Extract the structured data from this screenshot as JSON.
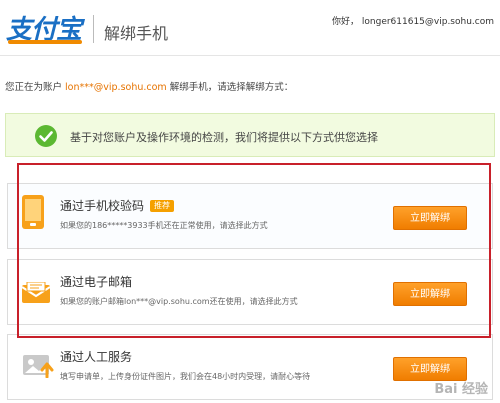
{
  "header": {
    "logo_text": "支付宝",
    "page_title": "解绑手机",
    "greeting": "你好， longer611615@vip.sohu.com"
  },
  "intro": {
    "prefix": "您正在为账户 ",
    "account": "lon***@vip.sohu.com",
    "suffix": " 解绑手机，请选择解绑方式："
  },
  "notice": {
    "text": "基于对您账户及操作环境的检测，我们将提供以下方式供您选择"
  },
  "options": [
    {
      "title": "通过手机校验码",
      "badge": "推荐",
      "desc": "如果您的186*****3933手机还在正常使用，请选择此方式",
      "button": "立即解绑",
      "icon": "phone-icon"
    },
    {
      "title": "通过电子邮箱",
      "desc": "如果您的账户邮箱lon***@vip.sohu.com还在使用，请选择此方式",
      "button": "立即解绑",
      "icon": "mail-icon"
    },
    {
      "title": "通过人工服务",
      "desc": "填写申请单，上传身份证件图片，我们会在48小时内受理，请耐心等待",
      "button": "立即解绑",
      "icon": "upload-icon"
    }
  ],
  "watermark": "Bai 经验",
  "colors": {
    "accent_orange": "#f07d00",
    "logo_blue": "#1a6fc4",
    "highlight_red": "#c8202a",
    "notice_bg": "#f2fbe0",
    "check_green": "#5cb832"
  }
}
